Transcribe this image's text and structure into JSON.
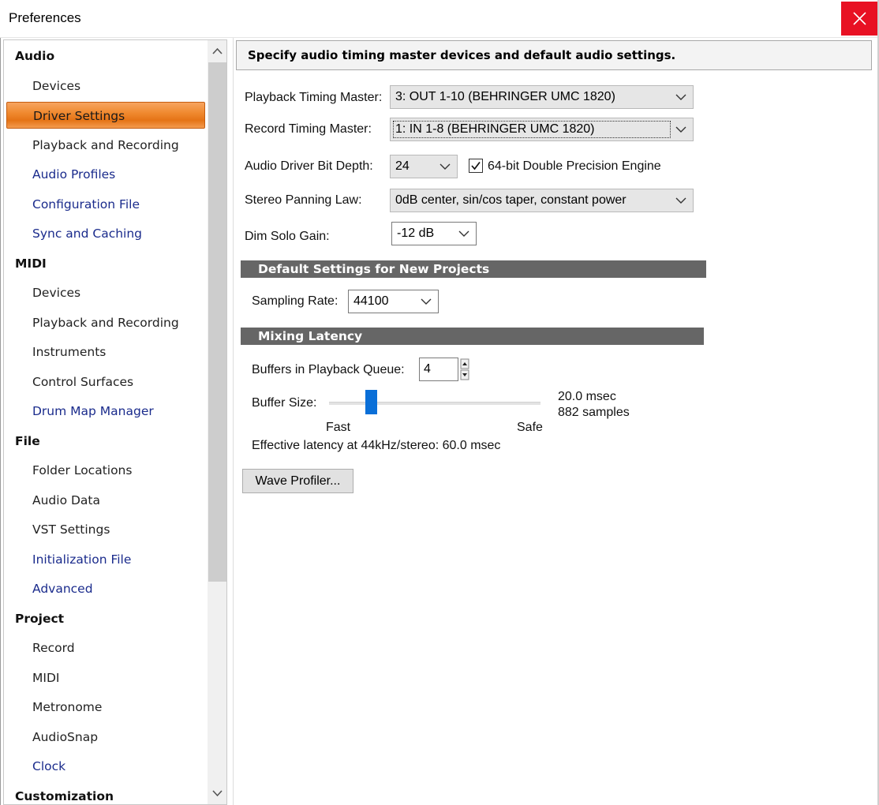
{
  "window": {
    "title": "Preferences"
  },
  "sidebar": {
    "items": [
      {
        "label": "Audio",
        "kind": "category"
      },
      {
        "label": "Devices",
        "kind": "item"
      },
      {
        "label": "Driver Settings",
        "kind": "item",
        "selected": true
      },
      {
        "label": "Playback and Recording",
        "kind": "item"
      },
      {
        "label": "Audio Profiles",
        "kind": "link"
      },
      {
        "label": "Configuration File",
        "kind": "link"
      },
      {
        "label": "Sync and Caching",
        "kind": "link"
      },
      {
        "label": "MIDI",
        "kind": "category"
      },
      {
        "label": "Devices",
        "kind": "item"
      },
      {
        "label": "Playback and Recording",
        "kind": "item"
      },
      {
        "label": "Instruments",
        "kind": "item"
      },
      {
        "label": "Control Surfaces",
        "kind": "item"
      },
      {
        "label": "Drum Map Manager",
        "kind": "link"
      },
      {
        "label": "File",
        "kind": "category"
      },
      {
        "label": "Folder Locations",
        "kind": "item"
      },
      {
        "label": "Audio Data",
        "kind": "item"
      },
      {
        "label": "VST Settings",
        "kind": "item"
      },
      {
        "label": "Initialization File",
        "kind": "link"
      },
      {
        "label": "Advanced",
        "kind": "link"
      },
      {
        "label": "Project",
        "kind": "category"
      },
      {
        "label": "Record",
        "kind": "item"
      },
      {
        "label": "MIDI",
        "kind": "item"
      },
      {
        "label": "Metronome",
        "kind": "item"
      },
      {
        "label": "AudioSnap",
        "kind": "item"
      },
      {
        "label": "Clock",
        "kind": "link"
      },
      {
        "label": "Customization",
        "kind": "category"
      }
    ]
  },
  "main": {
    "header": "Specify audio timing master devices and default audio settings.",
    "playback_master": {
      "label": "Playback Timing Master:",
      "value": "3: OUT 1-10 (BEHRINGER UMC 1820)"
    },
    "record_master": {
      "label": "Record Timing Master:",
      "value": "1: IN 1-8 (BEHRINGER UMC 1820)"
    },
    "bit_depth": {
      "label": "Audio Driver Bit Depth:",
      "value": "24"
    },
    "double_precision": {
      "label": "64-bit Double Precision Engine",
      "checked": true
    },
    "panning_law": {
      "label": "Stereo Panning Law:",
      "value": "0dB center, sin/cos taper, constant power"
    },
    "dim_solo": {
      "label": "Dim Solo Gain:",
      "value": "-12 dB"
    },
    "defaults_section": "Default Settings for New Projects",
    "sampling_rate": {
      "label": "Sampling Rate:",
      "value": "44100"
    },
    "latency_section": "Mixing Latency",
    "buffers_queue": {
      "label": "Buffers in Playback Queue:",
      "value": "4"
    },
    "buffer_size": {
      "label": "Buffer Size:",
      "fast_label": "Fast",
      "safe_label": "Safe",
      "msec": "20.0 msec",
      "samples": "882 samples",
      "slider_fraction": 0.18
    },
    "effective_latency": "Effective latency at 44kHz/stereo:  60.0 msec",
    "wave_profiler_label": "Wave Profiler..."
  },
  "colors": {
    "close_button": "#e81123",
    "selection": "#f08a30",
    "section_bar": "#666666",
    "slider_thumb": "#0a6fd8",
    "link_text": "#1a2b8c"
  },
  "icons": [
    "close-icon",
    "chevron-down-icon",
    "scroll-up-icon",
    "scroll-down-icon",
    "check-icon",
    "spin-up-icon",
    "spin-down-icon"
  ]
}
